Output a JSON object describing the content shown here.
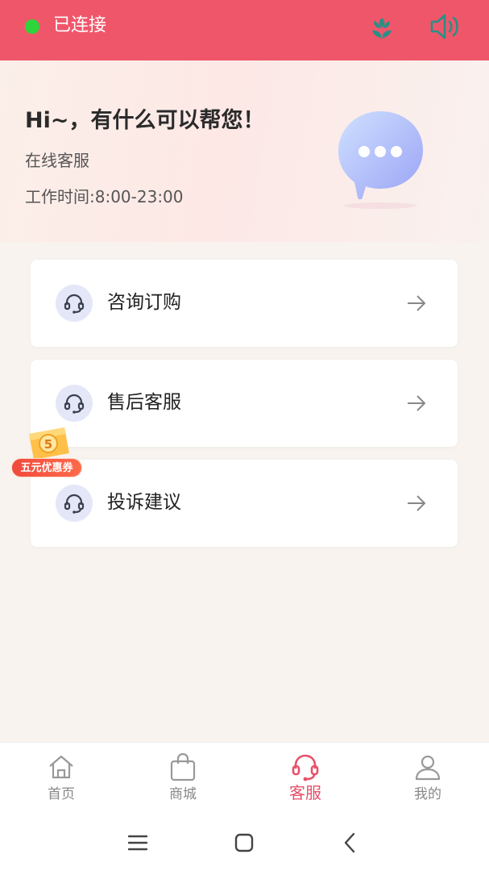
{
  "status": {
    "connection_label": "已连接",
    "connection_color": "#2ed43a",
    "bar_color": "#f0566a",
    "icons": [
      "flower-icon",
      "speaker-icon"
    ]
  },
  "hero": {
    "title": "Hi~，有什么可以帮您！",
    "subtitle": "在线客服",
    "hours": "工作时间:8:00-23:00",
    "icon": "chat-bubble-icon"
  },
  "menu": [
    {
      "label": "咨询订购",
      "icon": "headset-icon"
    },
    {
      "label": "售后客服",
      "icon": "headset-icon"
    },
    {
      "label": "投诉建议",
      "icon": "headset-icon"
    }
  ],
  "coupon": {
    "badge_number": "5",
    "label": "五元优惠券"
  },
  "tabs": [
    {
      "label": "首页",
      "icon": "home-icon",
      "active": false
    },
    {
      "label": "商城",
      "icon": "shopping-bag-icon",
      "active": false
    },
    {
      "label": "客服",
      "icon": "headset-icon",
      "active": true
    },
    {
      "label": "我的",
      "icon": "user-icon",
      "active": false
    }
  ],
  "accent_color": "#e8506a",
  "system_nav": [
    "menu-icon",
    "home-square-icon",
    "back-icon"
  ]
}
